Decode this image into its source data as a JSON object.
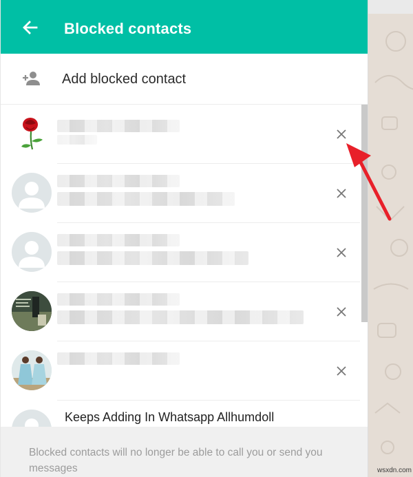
{
  "header": {
    "title": "Blocked contacts",
    "back_icon": "arrow-left-icon"
  },
  "add_contact": {
    "label": "Add blocked contact",
    "icon": "add-person-icon"
  },
  "contacts": [
    {
      "avatar": "rose-image",
      "name": "",
      "remove_icon": "close-icon"
    },
    {
      "avatar": "default-avatar",
      "name": "",
      "remove_icon": "close-icon"
    },
    {
      "avatar": "default-avatar",
      "name": "",
      "remove_icon": "close-icon"
    },
    {
      "avatar": "photo-avatar",
      "name": "",
      "remove_icon": "close-icon"
    },
    {
      "avatar": "photo-avatar",
      "name": "",
      "remove_icon": "close-icon"
    },
    {
      "avatar": "default-avatar",
      "name": "Keeps Adding In Whatsapp Allhumdoll"
    }
  ],
  "footer": {
    "text": "Blocked contacts will no longer be able to call you or send you messages"
  },
  "watermark": "wsxdn.com",
  "colors": {
    "header": "#00bfa5",
    "annotation_arrow": "#e8202a",
    "background_pattern": "#e5ddd5"
  }
}
